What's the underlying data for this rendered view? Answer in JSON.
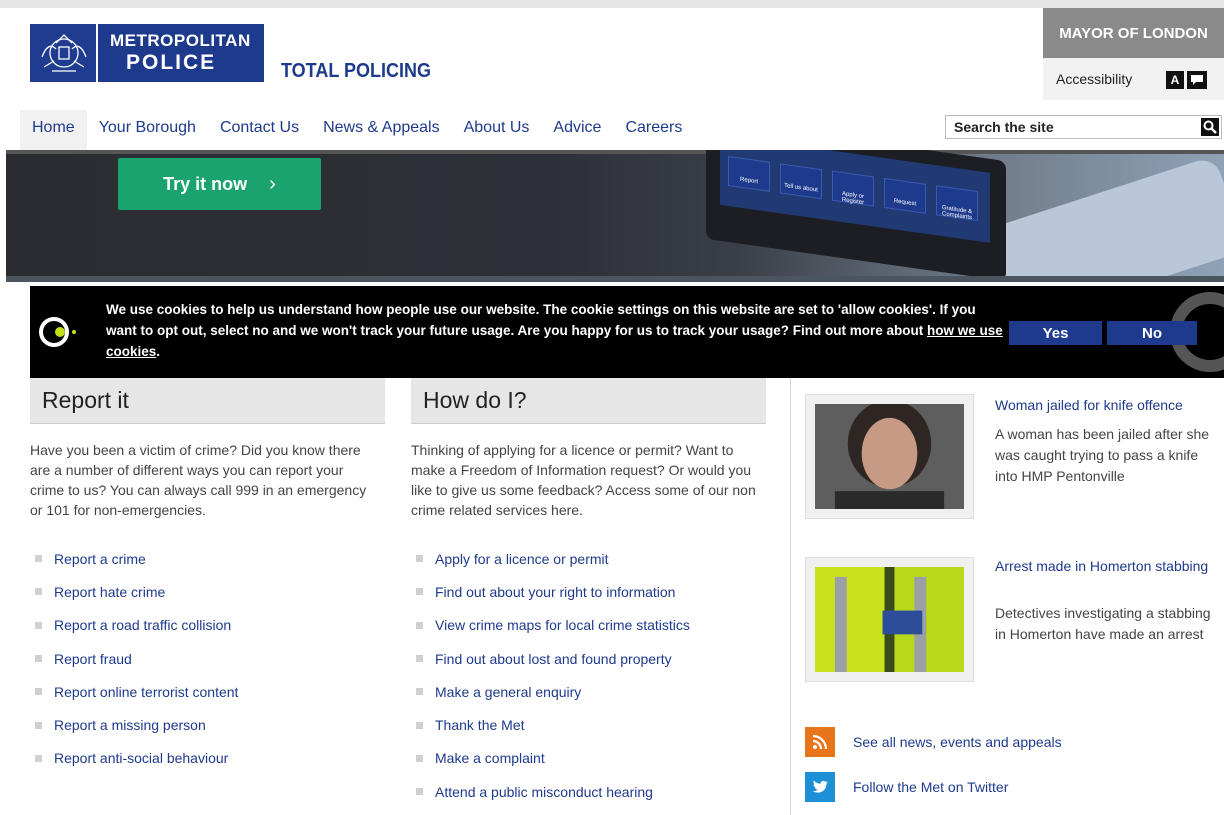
{
  "header": {
    "logo_line1": "METROPOLITAN",
    "logo_line2": "POLICE",
    "tagline": "TOTAL POLICING",
    "mayor": "MAYOR OF LONDON",
    "accessibility": "Accessibility",
    "text_size_label": "A",
    "brand_color": "#1e3a8c"
  },
  "nav": {
    "items": [
      "Home",
      "Your Borough",
      "Contact Us",
      "News & Appeals",
      "About Us",
      "Advice",
      "Careers"
    ],
    "active": "Home"
  },
  "search": {
    "placeholder": "Search the site",
    "icon": "search-icon"
  },
  "banner": {
    "button_label": "Try it now",
    "chevron": "›",
    "tile_labels": [
      "Report",
      "Tell us about",
      "Apply or Register",
      "Request",
      "Gratitude & Complaints"
    ],
    "button_color": "#1aa36e"
  },
  "cookie": {
    "text": "We use cookies to help us understand how people use our website. The cookie settings on this website are set to 'allow cookies'. If you want to opt out, select no and we won't track your future usage. Are you happy for us to track your usage? Find out more about ",
    "link": "how we use cookies",
    "after_link": ".",
    "yes": "Yes",
    "no": "No"
  },
  "report": {
    "heading": "Report it",
    "intro": "Have you been a victim of crime? Did you know there are a number of different ways you can report your crime to us? You can always call 999 in an emergency or 101 for non-emergencies.",
    "links": [
      "Report a crime",
      "Report hate crime",
      "Report a road traffic collision",
      "Report fraud",
      "Report online terrorist content",
      "Report a missing person",
      "Report anti-social behaviour"
    ]
  },
  "howdoi": {
    "heading": "How do I?",
    "intro": "Thinking of applying for a licence or permit? Want to make a Freedom of Information request? Or would you like to give us some feedback? Access some of our non crime related services here.",
    "links": [
      "Apply for a licence or permit",
      "Find out about your right to information",
      "View crime maps for local crime statistics",
      "Find out about lost and found property",
      "Make a general enquiry",
      "Thank the Met",
      "Make a complaint",
      "Attend a public misconduct hearing"
    ]
  },
  "news": [
    {
      "title": "Woman jailed for knife offence",
      "desc": "A woman has been jailed after she was caught trying to pass a knife into HMP Pentonville"
    },
    {
      "title": "Arrest made in Homerton stabbing",
      "desc": "Detectives investigating a stabbing in Homerton have made an arrest"
    }
  ],
  "side_links": [
    {
      "label": "See all news, events and appeals",
      "icon": "rss-icon",
      "color": "#e8751a"
    },
    {
      "label": "Follow the Met on Twitter",
      "icon": "twitter-icon",
      "color": "#1d8fd6"
    }
  ]
}
